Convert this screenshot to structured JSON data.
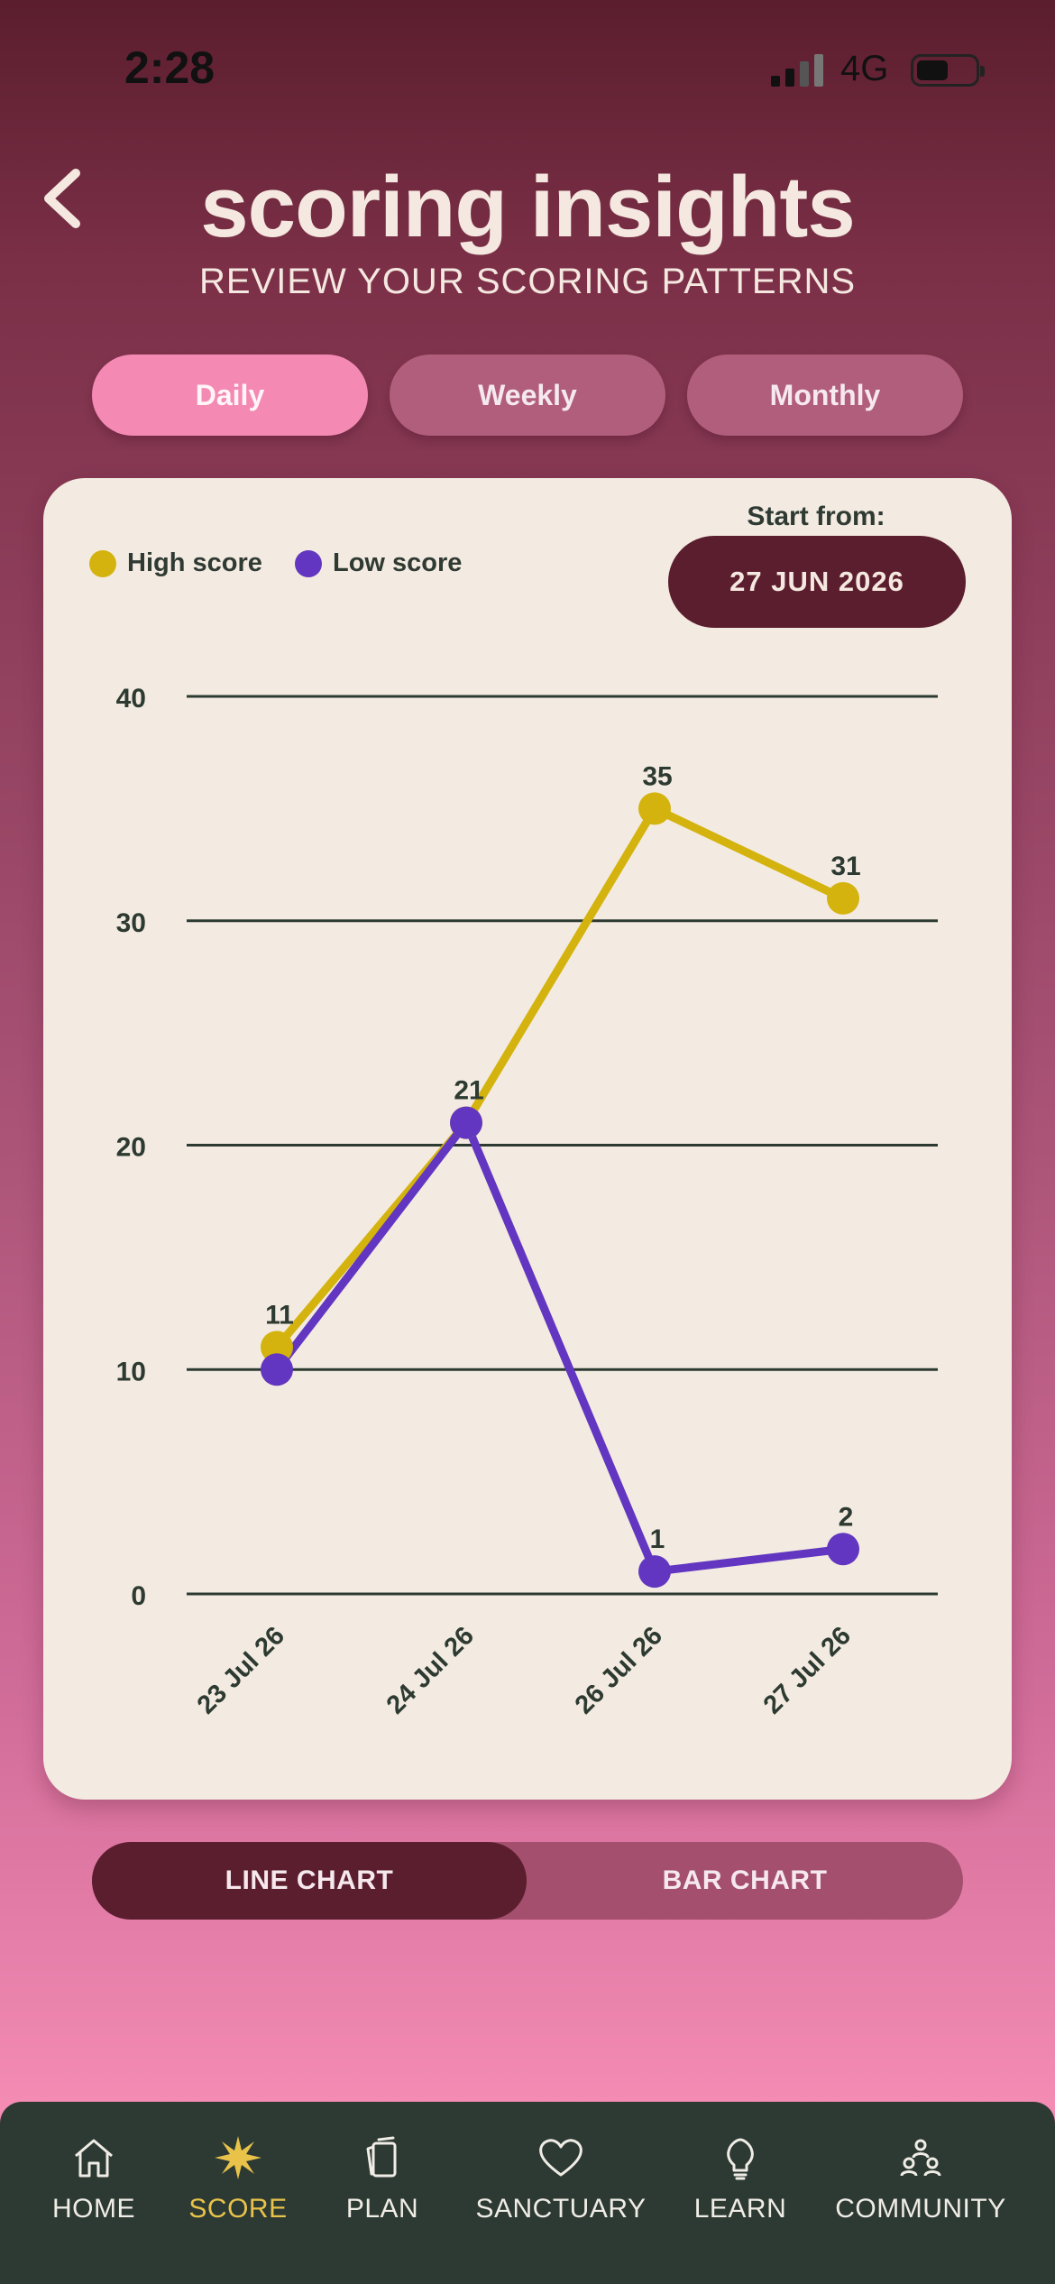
{
  "status_bar": {
    "time": "2:28",
    "network": "4G"
  },
  "header": {
    "title": "scoring insights",
    "subtitle": "REVIEW YOUR SCORING PATTERNS"
  },
  "period_tabs": [
    {
      "label": "Daily",
      "active": true
    },
    {
      "label": "Weekly",
      "active": false
    },
    {
      "label": "Monthly",
      "active": false
    }
  ],
  "start_from": {
    "label": "Start from:",
    "date": "27 JUN 2026"
  },
  "chart_toggle": {
    "line_label": "LINE CHART",
    "bar_label": "BAR CHART",
    "selected": "line"
  },
  "bottom_nav": [
    {
      "label": "HOME",
      "icon": "home-icon",
      "active": false
    },
    {
      "label": "SCORE",
      "icon": "star-burst-icon",
      "active": true
    },
    {
      "label": "PLAN",
      "icon": "cards-icon",
      "active": false
    },
    {
      "label": "SANCTUARY",
      "icon": "heart-icon",
      "active": false
    },
    {
      "label": "LEARN",
      "icon": "lightbulb-icon",
      "active": false
    },
    {
      "label": "COMMUNITY",
      "icon": "community-icon",
      "active": false
    }
  ],
  "colors": {
    "high": "#d4b30e",
    "low": "#6236c0",
    "accent": "#5b1e2e"
  },
  "chart_data": {
    "type": "line",
    "categories": [
      "23 Jul 26",
      "24 Jul 26",
      "26 Jul 26",
      "27 Jul 26"
    ],
    "series": [
      {
        "name": "High score",
        "values": [
          11,
          21,
          35,
          31
        ]
      },
      {
        "name": "Low score",
        "values": [
          10,
          21,
          1,
          2
        ]
      }
    ],
    "data_labels": [
      {
        "category": "23 Jul 26",
        "value": 11
      },
      {
        "category": "24 Jul 26",
        "value": 21
      },
      {
        "category": "26 Jul 26",
        "value": 35
      },
      {
        "category": "27 Jul 26",
        "value": 31
      },
      {
        "category": "26 Jul 26",
        "value": 1
      },
      {
        "category": "27 Jul 26",
        "value": 2
      }
    ],
    "yticks": [
      0,
      10,
      20,
      30,
      40
    ],
    "ylim": [
      0,
      40
    ],
    "grid": true,
    "legend_position": "top-left"
  }
}
